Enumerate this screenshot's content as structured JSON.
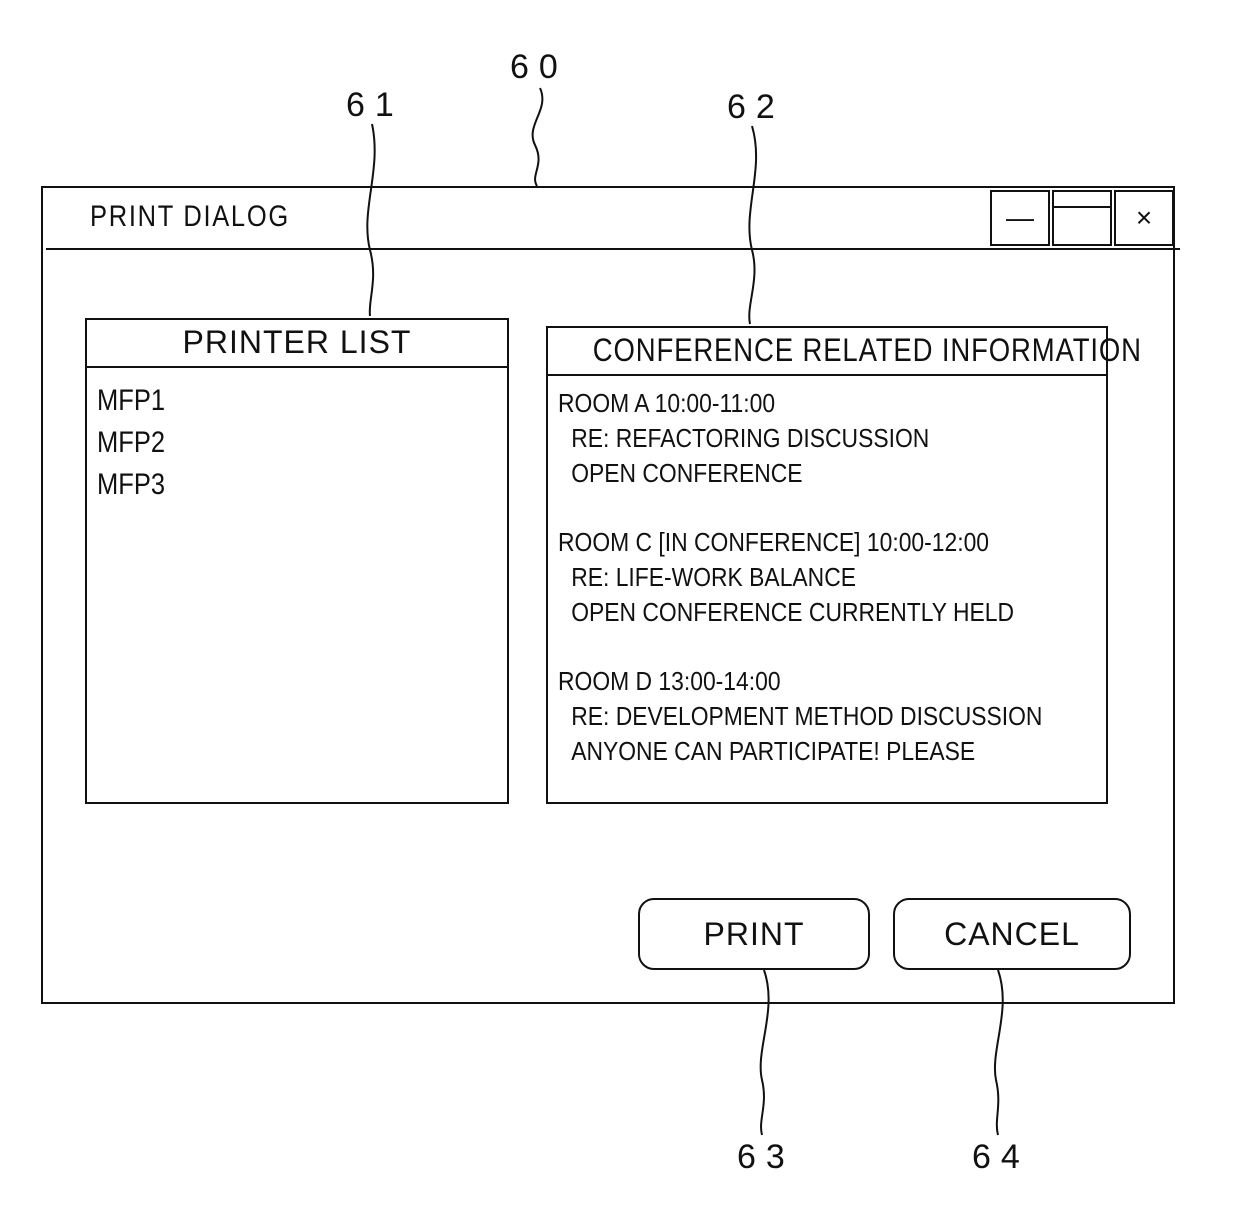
{
  "reference_numerals": {
    "window": "60",
    "printer_list": "61",
    "conference_info": "62",
    "print_button": "63",
    "cancel_button": "64"
  },
  "window": {
    "title": "PRINT DIALOG",
    "controls": {
      "minimize": "—",
      "maximize": "",
      "close": "×"
    }
  },
  "printer_list": {
    "header": "PRINTER LIST",
    "items": [
      "MFP1",
      "MFP2",
      "MFP3"
    ]
  },
  "conference_info": {
    "header": "CONFERENCE RELATED INFORMATION",
    "entries": [
      {
        "heading": "ROOM A 10:00-11:00",
        "subject": "RE: REFACTORING DISCUSSION",
        "note": "OPEN CONFERENCE"
      },
      {
        "heading": "ROOM C [IN CONFERENCE] 10:00-12:00",
        "subject": "RE: LIFE-WORK BALANCE",
        "note": "OPEN CONFERENCE CURRENTLY HELD"
      },
      {
        "heading": "ROOM D 13:00-14:00",
        "subject": "RE: DEVELOPMENT METHOD DISCUSSION",
        "note": "ANYONE CAN PARTICIPATE! PLEASE"
      }
    ]
  },
  "buttons": {
    "print": "PRINT",
    "cancel": "CANCEL"
  }
}
